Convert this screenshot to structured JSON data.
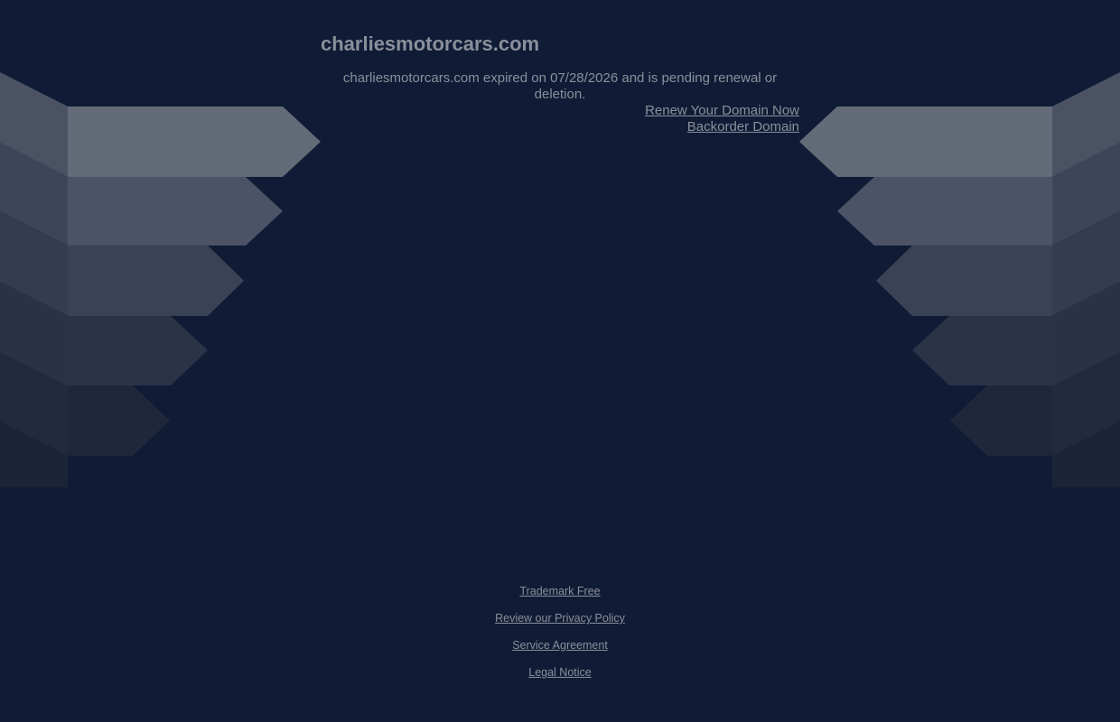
{
  "page": {
    "domain_title": "charliesmotorcars.com",
    "expiry_message": "charliesmotorcars.com expired on 07/28/2026 and is pending renewal or deletion."
  },
  "actions": {
    "renew_label": "Renew Your Domain Now",
    "backorder_label": "Backorder Domain"
  },
  "footer": {
    "links": [
      {
        "label": "Trademark Free"
      },
      {
        "label": "Review our Privacy Policy"
      },
      {
        "label": "Service Agreement"
      },
      {
        "label": "Legal Notice"
      }
    ]
  },
  "colors": {
    "background": "#101c36",
    "text": "#8a8f9b"
  }
}
